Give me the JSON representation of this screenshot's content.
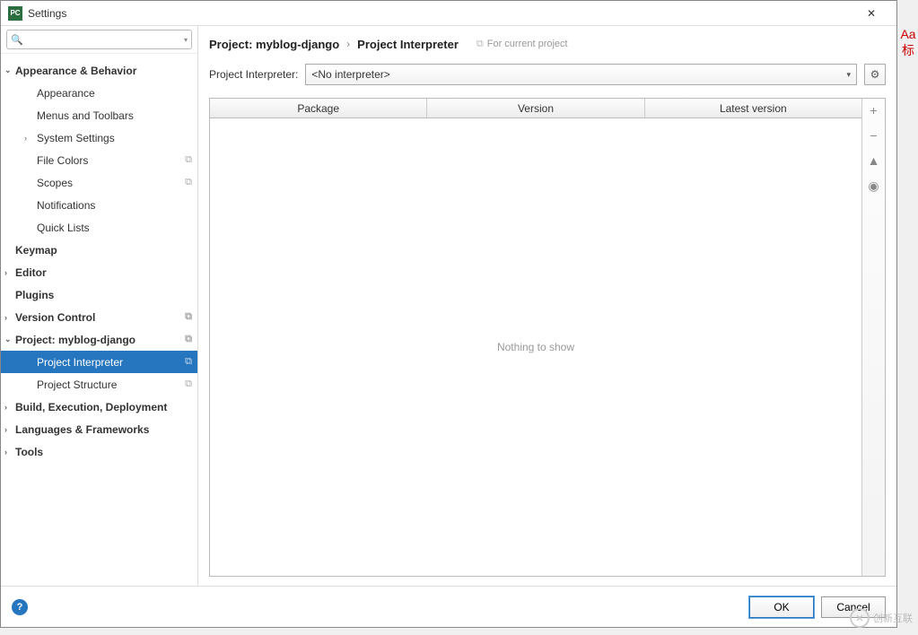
{
  "window": {
    "title": "Settings",
    "app_icon_text": "PC"
  },
  "search": {
    "placeholder": ""
  },
  "tree": [
    {
      "label": "Appearance & Behavior",
      "depth": 0,
      "chevron": "down",
      "copyable": false
    },
    {
      "label": "Appearance",
      "depth": 1,
      "chevron": "",
      "copyable": false
    },
    {
      "label": "Menus and Toolbars",
      "depth": 1,
      "chevron": "",
      "copyable": false
    },
    {
      "label": "System Settings",
      "depth": 1,
      "chevron": "right",
      "copyable": false
    },
    {
      "label": "File Colors",
      "depth": 1,
      "chevron": "",
      "copyable": true
    },
    {
      "label": "Scopes",
      "depth": 1,
      "chevron": "",
      "copyable": true
    },
    {
      "label": "Notifications",
      "depth": 1,
      "chevron": "",
      "copyable": false
    },
    {
      "label": "Quick Lists",
      "depth": 1,
      "chevron": "",
      "copyable": false
    },
    {
      "label": "Keymap",
      "depth": 0,
      "chevron": "",
      "copyable": false
    },
    {
      "label": "Editor",
      "depth": 0,
      "chevron": "right",
      "copyable": false
    },
    {
      "label": "Plugins",
      "depth": 0,
      "chevron": "",
      "copyable": false
    },
    {
      "label": "Version Control",
      "depth": 0,
      "chevron": "right",
      "copyable": true
    },
    {
      "label": "Project: myblog-django",
      "depth": 0,
      "chevron": "down",
      "copyable": true
    },
    {
      "label": "Project Interpreter",
      "depth": 1,
      "chevron": "",
      "copyable": true,
      "selected": true
    },
    {
      "label": "Project Structure",
      "depth": 1,
      "chevron": "",
      "copyable": true
    },
    {
      "label": "Build, Execution, Deployment",
      "depth": 0,
      "chevron": "right",
      "copyable": false
    },
    {
      "label": "Languages & Frameworks",
      "depth": 0,
      "chevron": "right",
      "copyable": false
    },
    {
      "label": "Tools",
      "depth": 0,
      "chevron": "right",
      "copyable": false
    }
  ],
  "breadcrumb": {
    "crumb1": "Project: myblog-django",
    "sep": "›",
    "crumb2": "Project Interpreter",
    "hint": "For current project"
  },
  "interpreter": {
    "label": "Project Interpreter:",
    "value": "<No interpreter>"
  },
  "table": {
    "headers": [
      "Package",
      "Version",
      "Latest version"
    ],
    "empty_text": "Nothing to show"
  },
  "tools": {
    "add": "+",
    "remove": "−",
    "up": "▲",
    "eye": "◉"
  },
  "buttons": {
    "ok": "OK",
    "cancel": "Cancel"
  },
  "watermark": {
    "text": "创新互联"
  },
  "right_strip": {
    "a": "Aa",
    "b": "标"
  }
}
